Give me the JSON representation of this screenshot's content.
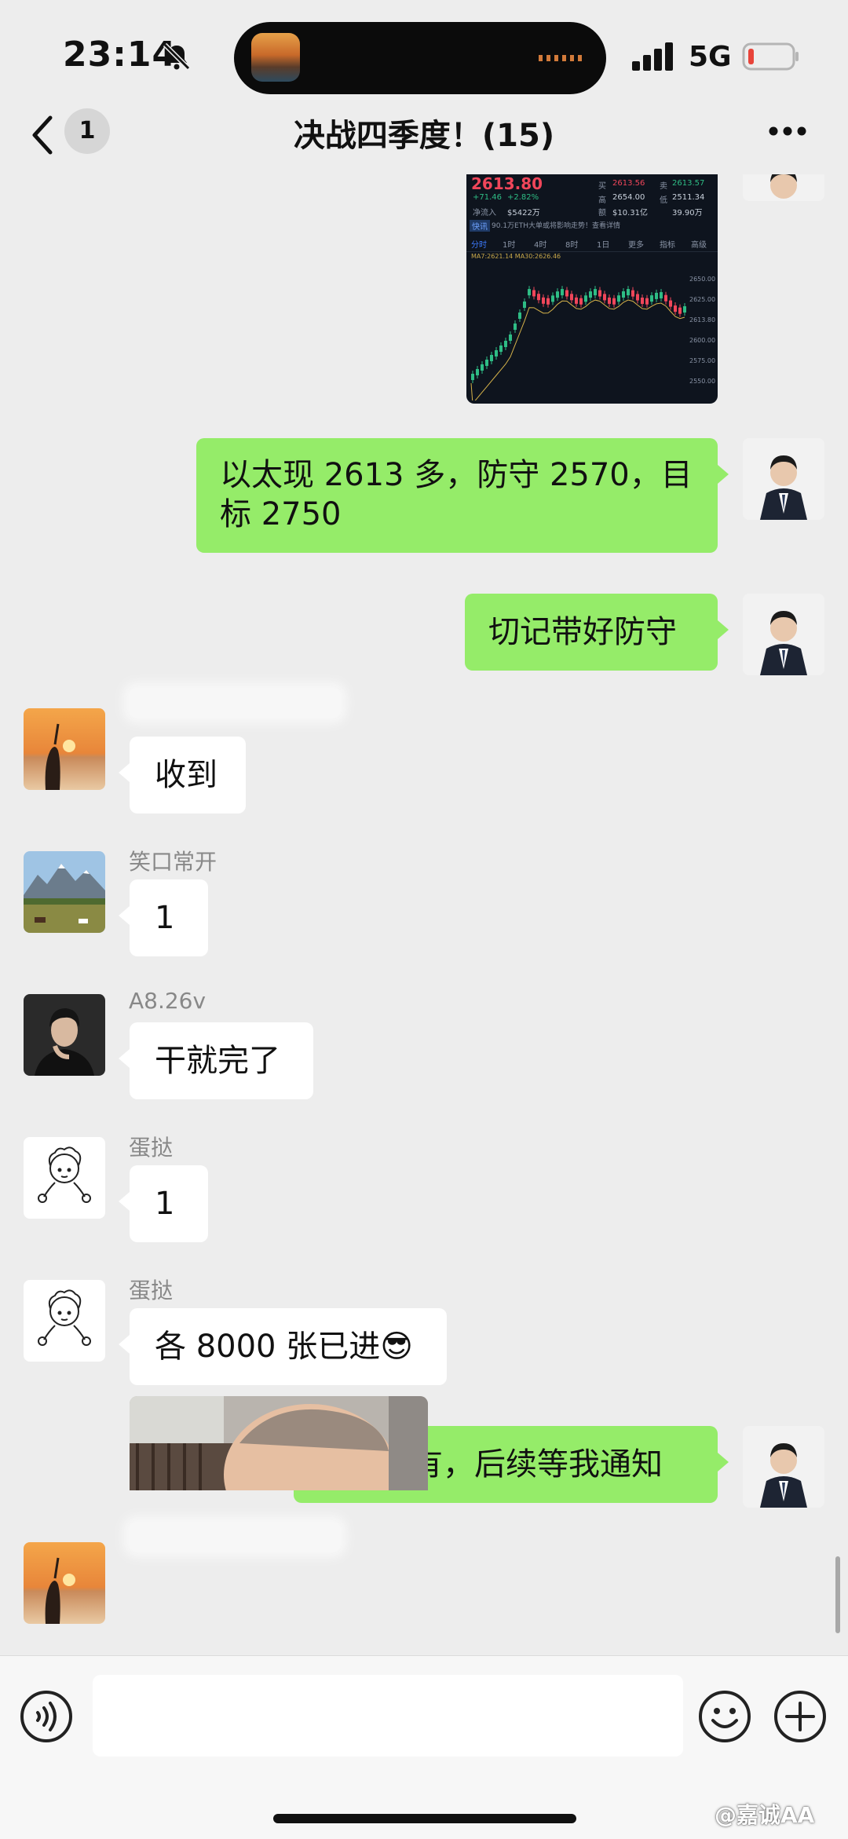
{
  "status_bar": {
    "time": "23:14",
    "network": "5G",
    "icons": [
      "bell-muted-icon",
      "signal-icon",
      "battery-low-icon"
    ],
    "battery_color": "#e8443a"
  },
  "header": {
    "back_icon": "chevron-left-icon",
    "unread_count": "1",
    "title": "决战四季度！(15)",
    "more_icon": "more-dots-icon"
  },
  "stock_image": {
    "price": "2613.80",
    "change": "+71.46",
    "change_pct": "+2.82%",
    "inflow_label": "净流入",
    "inflow_value": "$5422万",
    "buy_label": "买",
    "buy_value": "2613.56",
    "sell_label": "卖",
    "sell_value": "2613.57",
    "high_label": "高",
    "high_value": "2654.00",
    "low_label": "低",
    "low_value": "2511.34",
    "amount_label": "额",
    "amount_value": "$10.31亿",
    "volume_value": "39.90万",
    "news_tag": "快讯",
    "news_text": "90.1万ETH大单或将影响走势！查看详情",
    "tabs": [
      "分时",
      "1时",
      "4时",
      "8时",
      "1日",
      "更多",
      "指标",
      "高级"
    ],
    "ma_text": "MA7:2621.14  MA30:2626.46",
    "y_ticks": [
      "2650.00",
      "2625.00",
      "2613.80",
      "2600.00",
      "2575.00",
      "2550.00"
    ]
  },
  "messages": [
    {
      "id": "m1",
      "side": "out",
      "text": "以太现 2613 多，防守 2570，目标 2750"
    },
    {
      "id": "m2",
      "side": "out",
      "text": "切记带好防守"
    },
    {
      "id": "m3",
      "side": "in",
      "sender": "",
      "text": "收到"
    },
    {
      "id": "m4",
      "side": "in",
      "sender": "笑口常开",
      "text": "1"
    },
    {
      "id": "m5",
      "side": "in",
      "sender": "A8.26v",
      "text": "干就完了"
    },
    {
      "id": "m6",
      "side": "in",
      "sender": "蛋挞",
      "text": "1"
    },
    {
      "id": "m7",
      "side": "in",
      "sender": "蛋挞",
      "text": "各 8000 张已进😎"
    },
    {
      "id": "m8",
      "side": "out",
      "text": "耐心持有，后续等我通知"
    },
    {
      "id": "m9",
      "side": "in",
      "sender": "",
      "text": ""
    }
  ],
  "input_bar": {
    "placeholder": "",
    "icons": [
      "voice-icon",
      "emoji-icon",
      "add-icon"
    ]
  },
  "watermark": "@嘉诚AA"
}
